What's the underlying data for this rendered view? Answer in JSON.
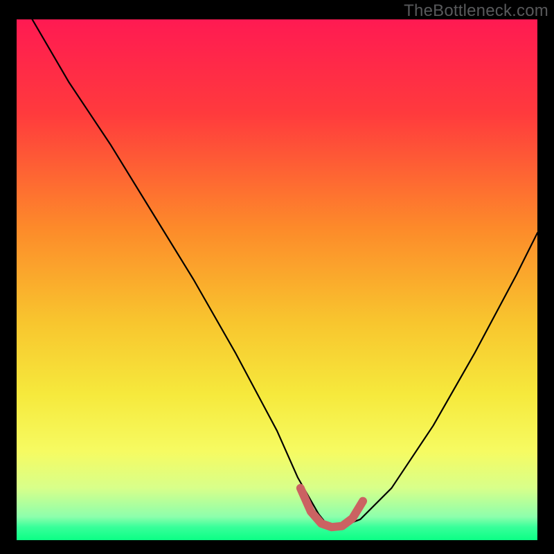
{
  "watermark": "TheBottleneck.com",
  "colors": {
    "frame": "#000000",
    "curve": "#000000",
    "highlight_stroke": "#cb6262",
    "gradient_stops": [
      {
        "offset": 0.0,
        "color": "#ff1a52"
      },
      {
        "offset": 0.18,
        "color": "#ff3a3d"
      },
      {
        "offset": 0.4,
        "color": "#fd8a2a"
      },
      {
        "offset": 0.58,
        "color": "#f8c52e"
      },
      {
        "offset": 0.72,
        "color": "#f6e93c"
      },
      {
        "offset": 0.83,
        "color": "#f6fb62"
      },
      {
        "offset": 0.9,
        "color": "#d8ff8a"
      },
      {
        "offset": 0.955,
        "color": "#8dffac"
      },
      {
        "offset": 0.975,
        "color": "#38ff9a"
      },
      {
        "offset": 1.0,
        "color": "#0bff85"
      }
    ]
  },
  "chart_data": {
    "type": "line",
    "title": "",
    "xlabel": "",
    "ylabel": "",
    "xlim": [
      0,
      100
    ],
    "ylim": [
      0,
      100
    ],
    "series": [
      {
        "name": "bottleneck-curve",
        "x": [
          3,
          10,
          18,
          26,
          34,
          42,
          50,
          54,
          58,
          60,
          62,
          66,
          72,
          80,
          88,
          96,
          100
        ],
        "y": [
          100,
          88,
          76,
          63,
          50,
          36,
          21,
          12,
          5,
          2.5,
          2.5,
          4,
          10,
          22,
          36,
          51,
          59
        ]
      }
    ],
    "highlight": {
      "name": "near-minimum",
      "x": [
        54.5,
        56.5,
        58.5,
        60.5,
        62.5,
        64.5,
        66.5
      ],
      "y": [
        10,
        5.5,
        3.2,
        2.5,
        2.7,
        4.2,
        7.5
      ]
    }
  }
}
